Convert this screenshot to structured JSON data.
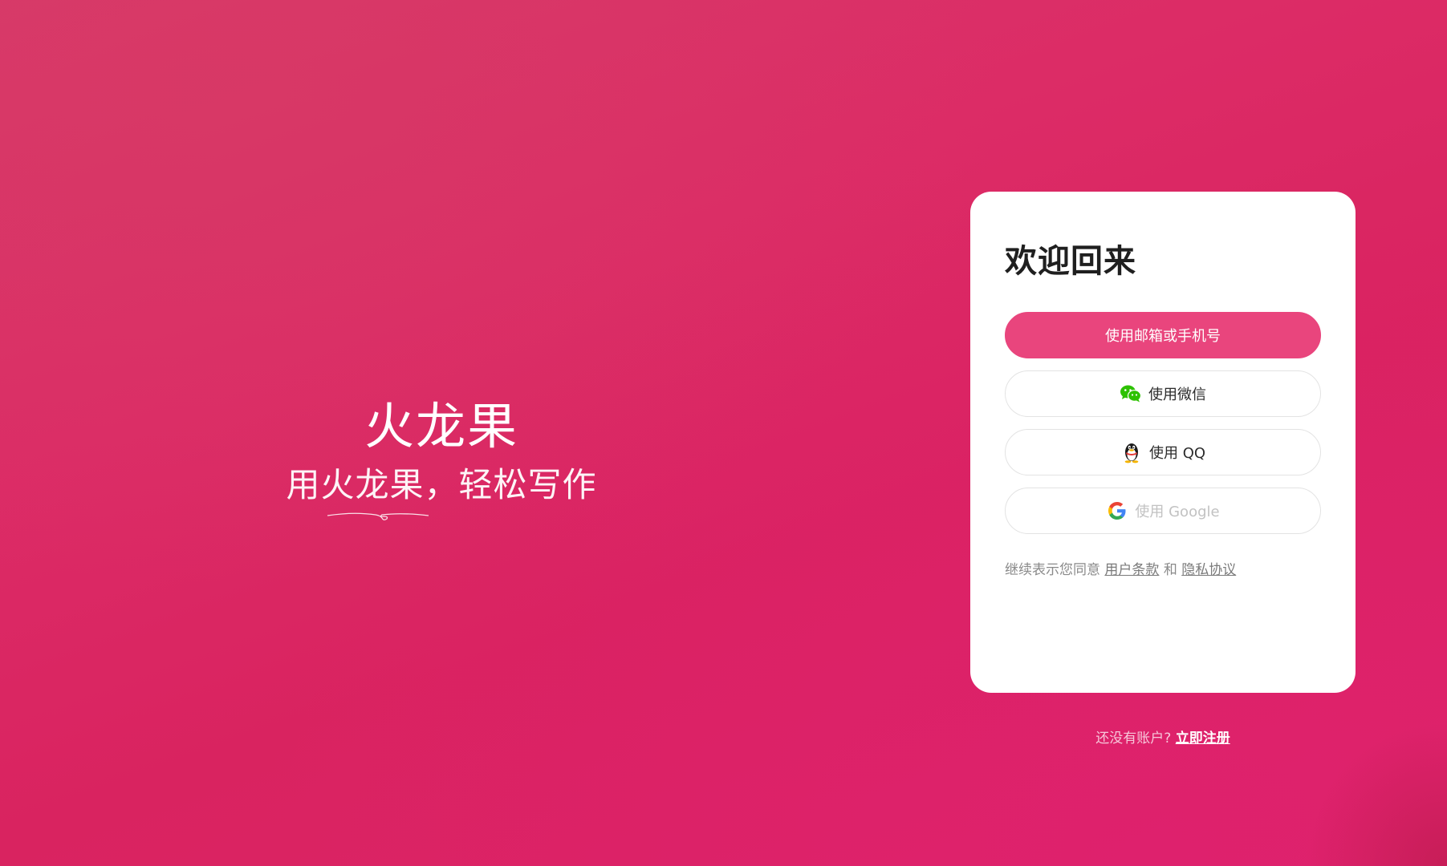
{
  "hero": {
    "title": "火龙果",
    "slogan": "用火龙果，轻松写作"
  },
  "card": {
    "title": "欢迎回来",
    "buttons": {
      "email_phone": "使用邮箱或手机号",
      "wechat": "使用微信",
      "qq": "使用 QQ",
      "google": "使用 Google"
    },
    "icons": {
      "wechat": "wechat-icon",
      "qq": "qq-penguin-icon",
      "google": "google-g-icon"
    },
    "terms": {
      "prefix": "继续表示您同意",
      "user_terms": "用户条款",
      "and": "和",
      "privacy": "隐私协议"
    }
  },
  "signup": {
    "prompt": "还没有账户?",
    "link": "立即注册"
  },
  "colors": {
    "background": "#dc2b66",
    "primary_button": "#e9457d",
    "card": "#ffffff",
    "wechat_green": "#2dc100"
  }
}
